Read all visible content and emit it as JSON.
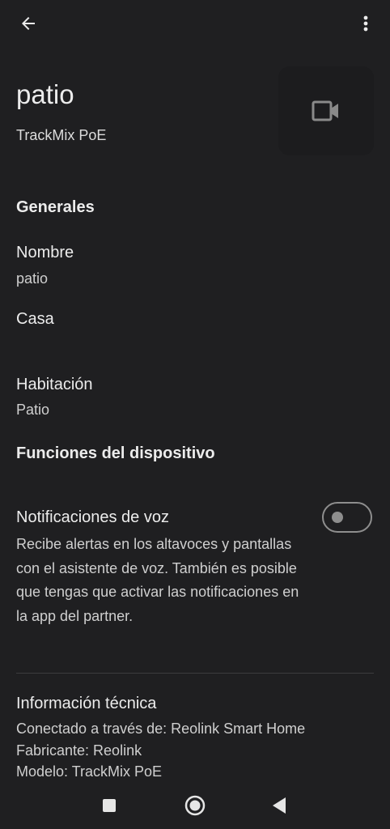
{
  "header": {
    "back_icon": "arrow-left-icon",
    "menu_icon": "more-vertical-icon"
  },
  "device": {
    "name": "patio",
    "model": "TrackMix PoE",
    "icon": "video-camera-icon"
  },
  "general": {
    "title": "Generales",
    "name_label": "Nombre",
    "name_value": "patio",
    "home_label": "Casa",
    "room_label": "Habitación",
    "room_value": "Patio"
  },
  "features": {
    "title": "Funciones del dispositivo",
    "voice_label": "Notificaciones de voz",
    "voice_description": "Recibe alertas en los altavoces y pantallas con el asistente de voz. También es posible que tengas que activar las notificaciones en la app del partner.",
    "voice_enabled": false
  },
  "tech": {
    "title": "Información técnica",
    "connected": "Conectado a través de: Reolink Smart Home",
    "manufacturer": "Fabricante: Reolink",
    "model": "Modelo: TrackMix PoE"
  },
  "navbar": {
    "icons": [
      "square-recents-icon",
      "circle-home-icon",
      "triangle-back-icon"
    ]
  },
  "colors": {
    "background": "#1f1f21",
    "text_primary": "#ececec",
    "text_secondary": "#cfcfcf",
    "toggle_off": "#8e8e8e"
  }
}
